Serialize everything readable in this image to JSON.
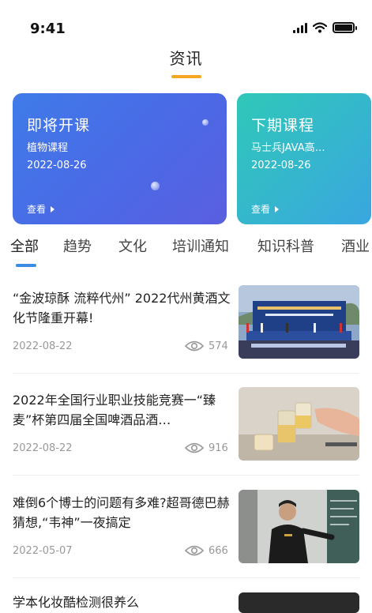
{
  "status_bar": {
    "time": "9:41"
  },
  "header": {
    "title": "资讯"
  },
  "banners": [
    {
      "title": "即将开课",
      "subtitle": "植物课程",
      "date": "2022-08-26",
      "link_label": "查看"
    },
    {
      "title": "下期课程",
      "subtitle": "马士兵JAVA高…",
      "date": "2022-08-26",
      "link_label": "查看"
    }
  ],
  "tabs": [
    "全部",
    "趋势",
    "文化",
    "培训通知",
    "知识科普",
    "酒业"
  ],
  "active_tab": "全部",
  "news": [
    {
      "title": "“金波琼酥 流粹代州” 2022代州黄酒文化节隆重开幕!",
      "date": "2022-08-22",
      "views": "574"
    },
    {
      "title": "2022年全国行业职业技能竞赛一“臻麦”杯第四届全国啤酒品酒…",
      "date": "2022-08-22",
      "views": "916"
    },
    {
      "title": "难倒6个博士的问题有多难?超哥德巴赫猜想,“韦神”一夜搞定",
      "date": "2022-05-07",
      "views": "666"
    },
    {
      "title": "学本化妆酷检测很养么"
    }
  ],
  "colors": {
    "accent": "#3a8de0",
    "title_underline": "#f5a623",
    "banner_blue": "#4b69e6",
    "banner_teal": "#2fc8b8"
  }
}
